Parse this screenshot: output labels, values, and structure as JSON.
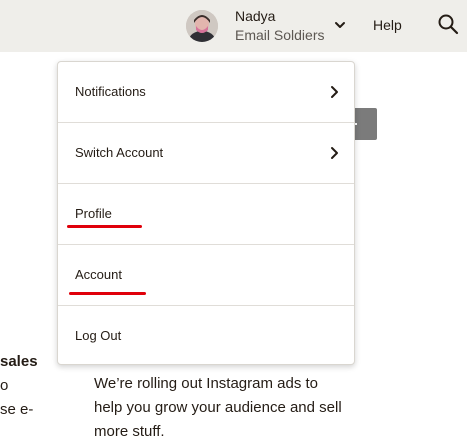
{
  "header": {
    "user_name": "Nadya",
    "org_name": "Email Soldiers",
    "help_label": "Help",
    "icons": {
      "avatar": "avatar",
      "account_chevron": "chevron-down-icon",
      "search": "search-icon"
    }
  },
  "dropdown": {
    "items": [
      {
        "label": "Notifications",
        "icon": "chevron-right-icon"
      },
      {
        "label": "Switch Account",
        "icon": "chevron-right-icon"
      },
      {
        "label": "Profile",
        "annotation": "red-underline"
      },
      {
        "label": "Account",
        "annotation": "red-underline"
      },
      {
        "label": "Log Out"
      }
    ]
  },
  "background": {
    "left_fragments": [
      "sales",
      "o",
      "se e-"
    ],
    "paragraph_lines": [
      "We’re rolling out Instagram ads to",
      "help you grow your audience and sell",
      "more stuff."
    ]
  },
  "colors": {
    "topbar_bg": "#efeeea",
    "annotation_red": "#e0000a",
    "text": "#241c15"
  }
}
